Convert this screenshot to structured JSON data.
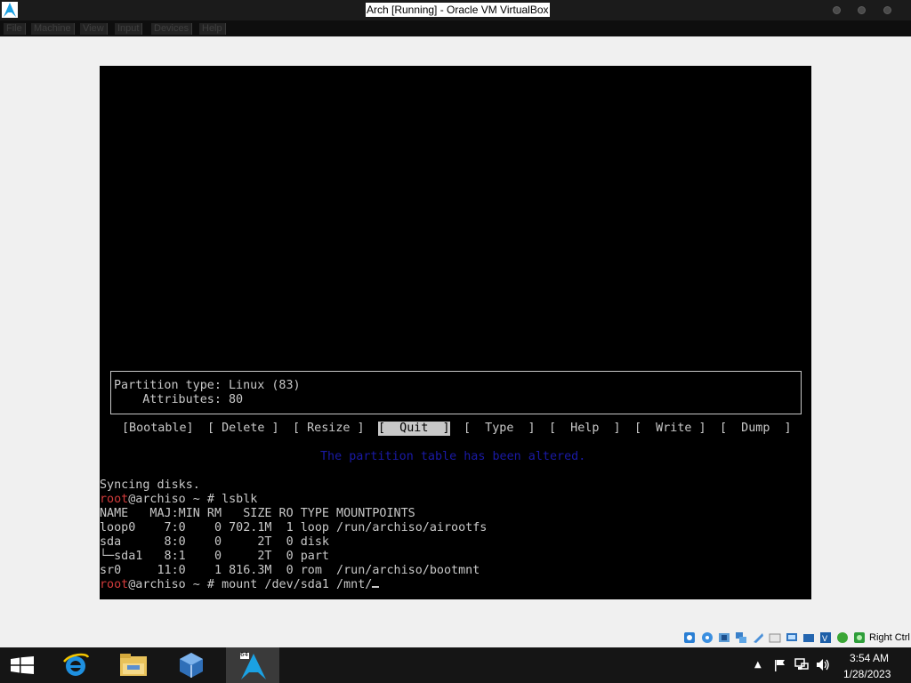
{
  "window": {
    "title": "Arch [Running] - Oracle VM VirtualBox"
  },
  "menubar": {
    "items": [
      {
        "label": "File"
      },
      {
        "label": "Machine"
      },
      {
        "label": "View"
      },
      {
        "label": "Input"
      },
      {
        "label": "Devices"
      },
      {
        "label": "Help"
      }
    ]
  },
  "cfdisk": {
    "partition_type": "Partition type: Linux (83)",
    "attributes": "    Attributes: 80",
    "buttons": [
      {
        "label": "[Bootable]"
      },
      {
        "label": "[ Delete ]"
      },
      {
        "label": "[ Resize ]"
      },
      {
        "label": "[  Quit  ]"
      },
      {
        "label": "[  Type  ]"
      },
      {
        "label": "[  Help  ]"
      },
      {
        "label": "[  Write ]"
      },
      {
        "label": "[  Dump  ]"
      }
    ],
    "message": "The partition table has been altered."
  },
  "terminal": {
    "syncing": "Syncing disks.",
    "prompt_user": "root",
    "prompt_host": "@archiso ~ # ",
    "cmd1": "lsblk",
    "lsblk_header": "NAME   MAJ:MIN RM   SIZE RO TYPE MOUNTPOINTS",
    "lsblk_rows": [
      "loop0    7:0    0 702.1M  1 loop /run/archiso/airootfs",
      "sda      8:0    0     2T  0 disk",
      "└─sda1   8:1    0     2T  0 part",
      "sr0     11:0    1 816.3M  0 rom  /run/archiso/bootmnt"
    ],
    "cmd2": "mount /dev/sda1 /mnt/"
  },
  "statusbar": {
    "host_key": "Right Ctrl"
  },
  "taskbar": {
    "clock_time": "3:54 AM",
    "clock_date": "1/28/2023",
    "vbox_badge": "64"
  },
  "colors": {
    "accent_blue": "#1ba1e2",
    "prompt_red": "#d23b3b",
    "terminal_fg": "#c8c8c8",
    "message_blue": "#1a1aa6"
  }
}
